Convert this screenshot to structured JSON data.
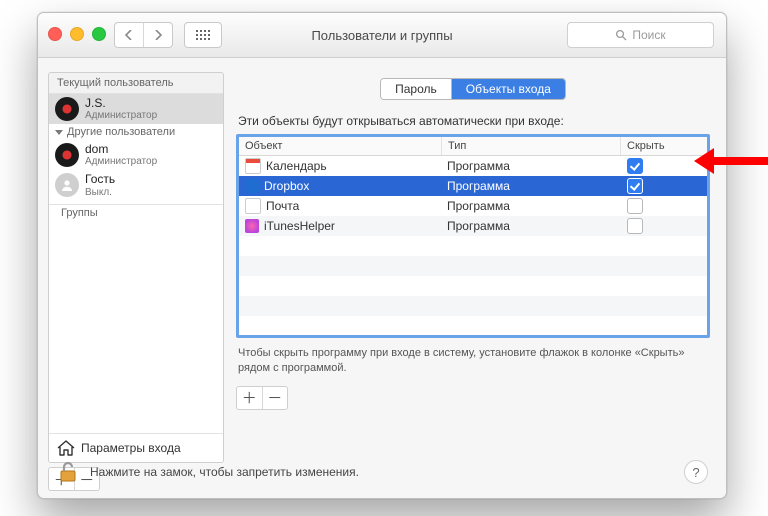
{
  "window": {
    "title": "Пользователи и группы",
    "search_placeholder": "Поиск"
  },
  "sidebar": {
    "current_user_header": "Текущий пользователь",
    "other_users_header": "Другие пользователи",
    "groups_header": "Группы",
    "login_params_label": "Параметры входа",
    "users": {
      "current": {
        "name": "J.S.",
        "role": "Администратор"
      },
      "others": [
        {
          "name": "dom",
          "role": "Администратор"
        },
        {
          "name": "Гость",
          "role": "Выкл."
        }
      ]
    }
  },
  "tabs": {
    "password": "Пароль",
    "login_items": "Объекты входа"
  },
  "login_items": {
    "caption": "Эти объекты будут открываться автоматически при входе:",
    "columns": {
      "object": "Объект",
      "type": "Тип",
      "hide": "Скрыть"
    },
    "rows": [
      {
        "name": "Календарь",
        "type": "Программа",
        "hidden": true,
        "selected": false,
        "icon": "cal"
      },
      {
        "name": "Dropbox",
        "type": "Программа",
        "hidden": true,
        "selected": true,
        "icon": "db"
      },
      {
        "name": "Почта",
        "type": "Программа",
        "hidden": false,
        "selected": false,
        "icon": "mail"
      },
      {
        "name": "iTunesHelper",
        "type": "Программа",
        "hidden": false,
        "selected": false,
        "icon": "it"
      }
    ],
    "hint": "Чтобы скрыть программу при входе в систему, установите флажок в колонке «Скрыть» рядом с программой."
  },
  "footer": {
    "lock_text": "Нажмите на замок, чтобы запретить изменения."
  },
  "glyphs": {
    "plus": "＋",
    "minus": "－",
    "help": "?"
  }
}
